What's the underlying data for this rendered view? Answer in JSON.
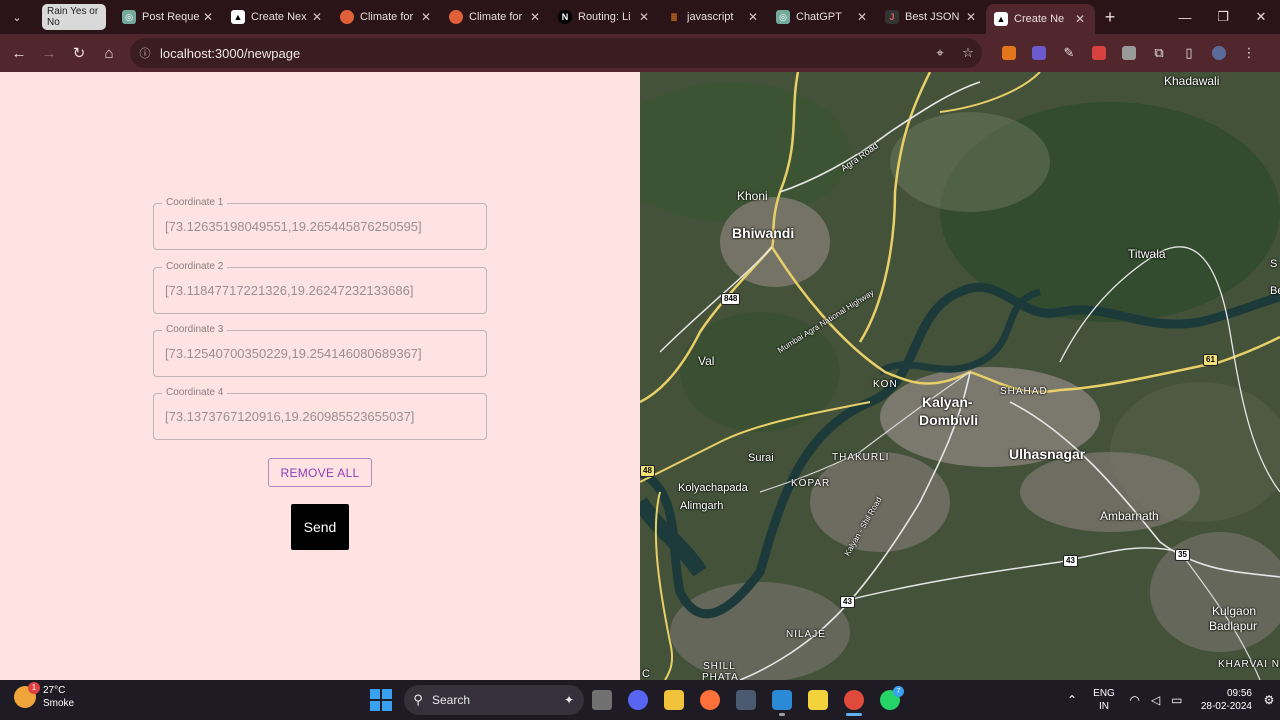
{
  "browser": {
    "group_chip": "Rain Yes or No",
    "tabs": [
      {
        "title": "Post Reque",
        "icon": "chatgpt-icon",
        "color": "#74aa9c"
      },
      {
        "title": "Create Nex",
        "icon": "nextjs-triangle-icon",
        "color": "#000000"
      },
      {
        "title": "Climate for",
        "icon": "climate-icon",
        "color": "#e0603a"
      },
      {
        "title": "Climate for",
        "icon": "climate-icon",
        "color": "#e0603a"
      },
      {
        "title": "Routing: Li",
        "icon": "nextjs-icon",
        "color": "#000000"
      },
      {
        "title": "javascript",
        "icon": "stackoverflow-icon",
        "color": "#f48024"
      },
      {
        "title": "ChatGPT",
        "icon": "chatgpt-icon",
        "color": "#74aa9c"
      },
      {
        "title": "Best JSON",
        "icon": "json-icon",
        "color": "#333333"
      },
      {
        "title": "Create Ne",
        "icon": "nextjs-triangle-icon",
        "color": "#000000"
      }
    ],
    "new_tab": "+",
    "url": "localhost:3000/newpage"
  },
  "form": {
    "coordinates": [
      {
        "label": "Coordinate 1",
        "value": "[73.12635198049551,19.265445876250595]"
      },
      {
        "label": "Coordinate 2",
        "value": "[73.11847717221326,19.26247232133686]"
      },
      {
        "label": "Coordinate 3",
        "value": "[73.12540700350229,19.254146080689367]"
      },
      {
        "label": "Coordinate 4",
        "value": "[73.1373767120916,19.260985523655037]"
      }
    ],
    "remove_all_label": "REMOVE ALL",
    "send_label": "Send"
  },
  "map": {
    "places": {
      "khadawali": "Khadawali",
      "khoni": "Khoni",
      "bhiwandi": "Bhiwandi",
      "titwala": "Titwala",
      "belk": "Belk",
      "s": "S",
      "val": "Val",
      "kon": "KON",
      "shahad": "SHAHAD",
      "kalyan1": "Kalyan-",
      "kalyan2": "Dombivli",
      "ulhasnagar": "Ulhasnagar",
      "surai": "Surai",
      "thakurli": "THAKURLI",
      "kopar": "KOPAR",
      "kolyachapada": "Kolyachapada",
      "alimgarh": "Alimgarh",
      "ambarnath": "Ambarnath",
      "kulgaon": "Kulgaon",
      "badlapur": "Badlapur",
      "nilaje": "NILAJE",
      "shill": "SHILL",
      "phata": "PHATA",
      "kharvai": "KHARVAI NA",
      "c": "C"
    },
    "roads": {
      "agra": "Agra Road",
      "mumbai_agra": "Mumbai Agra National Highway",
      "kalyan_shil": "Kalyan - Shil Road"
    },
    "shields": {
      "s848": "848",
      "s61": "61",
      "s43a": "43",
      "s43b": "43",
      "s35": "35",
      "s48": "48"
    }
  },
  "taskbar": {
    "weather_temp": "27°C",
    "weather_desc": "Smoke",
    "weather_badge": "1",
    "search_label": "Search",
    "whatsapp_badge": "7",
    "lang1": "ENG",
    "lang2": "IN",
    "time": "09:56",
    "date": "28-02-2024"
  }
}
